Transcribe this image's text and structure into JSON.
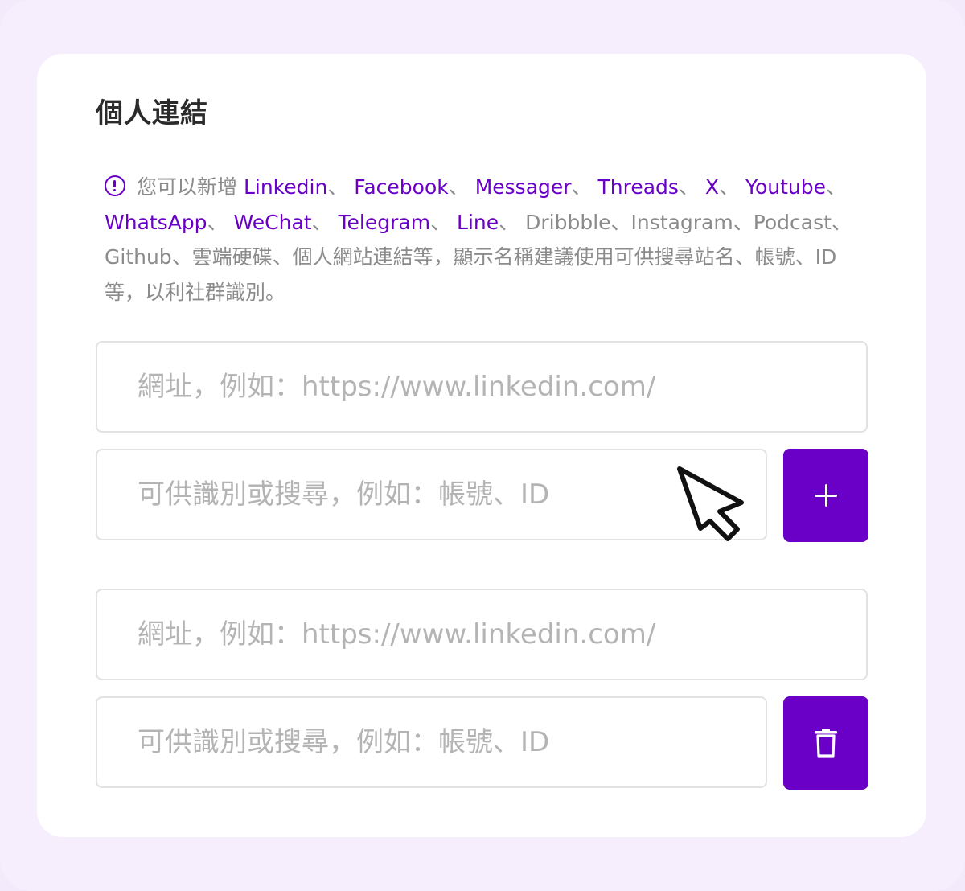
{
  "section": {
    "title": "個人連結"
  },
  "hint": {
    "icon": "info-circle-icon",
    "prefix": "您可以新增 ",
    "links": [
      "Linkedin",
      "Facebook",
      "Messager",
      "Threads",
      "X",
      "Youtube",
      "WhatsApp",
      "WeChat",
      "Telegram",
      "Line"
    ],
    "separator": "、 ",
    "rest": "Dribbble、Instagram、Podcast、Github、雲端硬碟、個人網站連結等，顯示名稱建議使用可供搜尋站名、帳號、ID等，以利社群識別。"
  },
  "link_groups": [
    {
      "url": {
        "value": "",
        "placeholder": "網址，例如：https://www.linkedin.com/"
      },
      "name": {
        "value": "",
        "placeholder": "可供識別或搜尋，例如：帳號、ID"
      },
      "action": {
        "icon": "plus-icon"
      }
    },
    {
      "url": {
        "value": "",
        "placeholder": "網址，例如：https://www.linkedin.com/"
      },
      "name": {
        "value": "",
        "placeholder": "可供識別或搜尋，例如：帳號、ID"
      },
      "action": {
        "icon": "trash-icon"
      }
    }
  ],
  "colors": {
    "accent": "#6a00c8",
    "background": "#f6eefc",
    "card": "#ffffff",
    "muted_text": "#8b8b8b",
    "border": "#e2e2e2"
  }
}
